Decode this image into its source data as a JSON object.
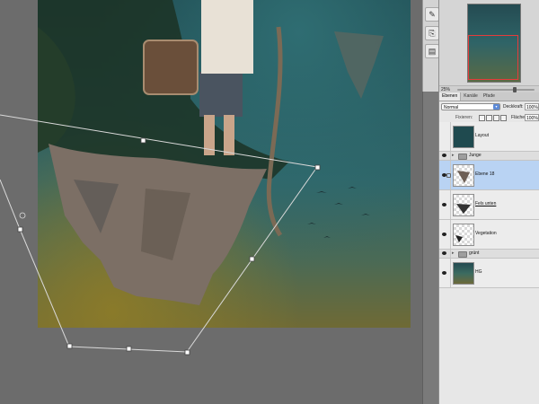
{
  "panel_tabs": [
    "Ebenen",
    "Kanäle",
    "Pfade"
  ],
  "navigator": {
    "zoom": "25%"
  },
  "layers_panel": {
    "blend_mode": "Normal",
    "opacity_label": "Deckkraft:",
    "opacity_value": "100%",
    "lock_label": "Fixieren:",
    "fill_label": "Fläche:",
    "fill_value": "100%"
  },
  "layers": [
    {
      "name": "Layout",
      "type": "layer",
      "visible": false
    },
    {
      "name": "Junge",
      "type": "group",
      "visible": true
    },
    {
      "name": "Ebene 18",
      "type": "layer",
      "visible": true,
      "selected": true
    },
    {
      "name": "Fels unten",
      "type": "layer",
      "visible": true
    },
    {
      "name": "Vegetation",
      "type": "layer",
      "visible": true
    },
    {
      "name": "grünt",
      "type": "group",
      "visible": true
    },
    {
      "name": "HG",
      "type": "layer",
      "visible": true
    }
  ],
  "tools": [
    "brush-preset-icon",
    "clone-source-icon",
    "actions-icon"
  ],
  "colors": {
    "selection": "#b9d3f3",
    "nav_view": "#e53b3b",
    "accent": "#5d8ad6"
  }
}
